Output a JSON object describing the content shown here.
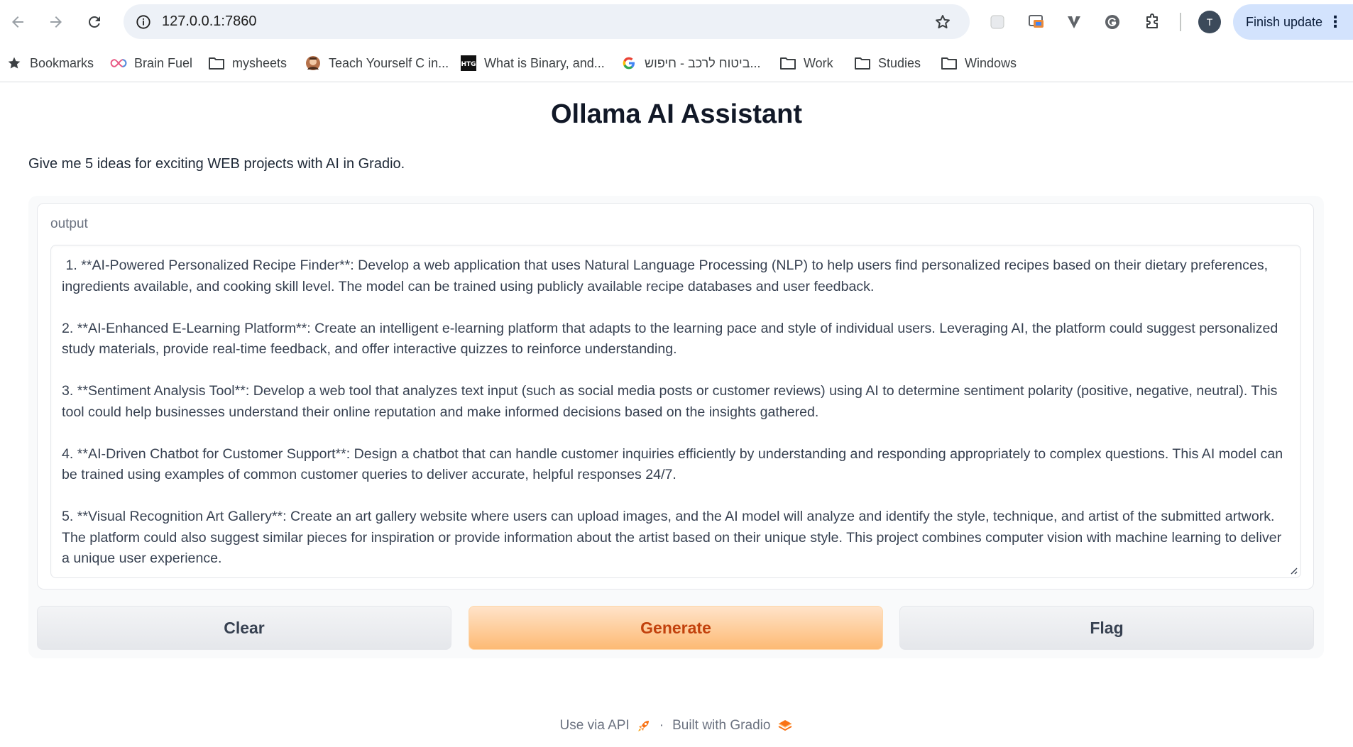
{
  "browser": {
    "url": "127.0.0.1:7860",
    "profile_initial": "T",
    "finish_update_label": "Finish update",
    "bookmarks": [
      {
        "label": "Bookmarks",
        "icon": "star-icon"
      },
      {
        "label": "Brain Fuel",
        "icon": "infinity-icon"
      },
      {
        "label": "mysheets",
        "icon": "folder-icon"
      },
      {
        "label": "Teach Yourself C in...",
        "icon": "avatar-icon"
      },
      {
        "label": "What is Binary, and...",
        "icon": "htg-icon"
      },
      {
        "label": "ביטוח לרכב - חיפוש...",
        "icon": "google-icon"
      },
      {
        "label": "Work",
        "icon": "folder-icon"
      },
      {
        "label": "Studies",
        "icon": "folder-icon"
      },
      {
        "label": "Windows",
        "icon": "folder-icon"
      }
    ]
  },
  "app": {
    "title": "Ollama AI Assistant",
    "description": "Give me 5 ideas for exciting WEB projects with AI in Gradio.",
    "output": {
      "label": "output",
      "paragraphs": [
        " 1. **AI-Powered Personalized Recipe Finder**: Develop a web application that uses Natural Language Processing (NLP) to help users find personalized recipes based on their dietary preferences, ingredients available, and cooking skill level. The model can be trained using publicly available recipe databases and user feedback.",
        "2. **AI-Enhanced E-Learning Platform**: Create an intelligent e-learning platform that adapts to the learning pace and style of individual users. Leveraging AI, the platform could suggest personalized study materials, provide real-time feedback, and offer interactive quizzes to reinforce understanding.",
        "3. **Sentiment Analysis Tool**: Develop a web tool that analyzes text input (such as social media posts or customer reviews) using AI to determine sentiment polarity (positive, negative, neutral). This tool could help businesses understand their online reputation and make informed decisions based on the insights gathered.",
        "4. **AI-Driven Chatbot for Customer Support**: Design a chatbot that can handle customer inquiries efficiently by understanding and responding appropriately to complex questions. This AI model can be trained using examples of common customer queries to deliver accurate, helpful responses 24/7.",
        "5. **Visual Recognition Art Gallery**: Create an art gallery website where users can upload images, and the AI model will analyze and identify the style, technique, and artist of the submitted artwork. The platform could also suggest similar pieces for inspiration or provide information about the artist based on their unique style. This project combines computer vision with machine learning to deliver a unique user experience."
      ]
    },
    "buttons": {
      "clear": "Clear",
      "generate": "Generate",
      "flag": "Flag"
    },
    "footer": {
      "api": "Use via API",
      "separator": "·",
      "built_with": "Built with Gradio"
    }
  },
  "colors": {
    "primary_button_text": "#c2410c",
    "primary_button_bg": "#fdba74",
    "omnibox_bg": "#edf1f7",
    "update_chip_bg": "#d3e3fd"
  }
}
